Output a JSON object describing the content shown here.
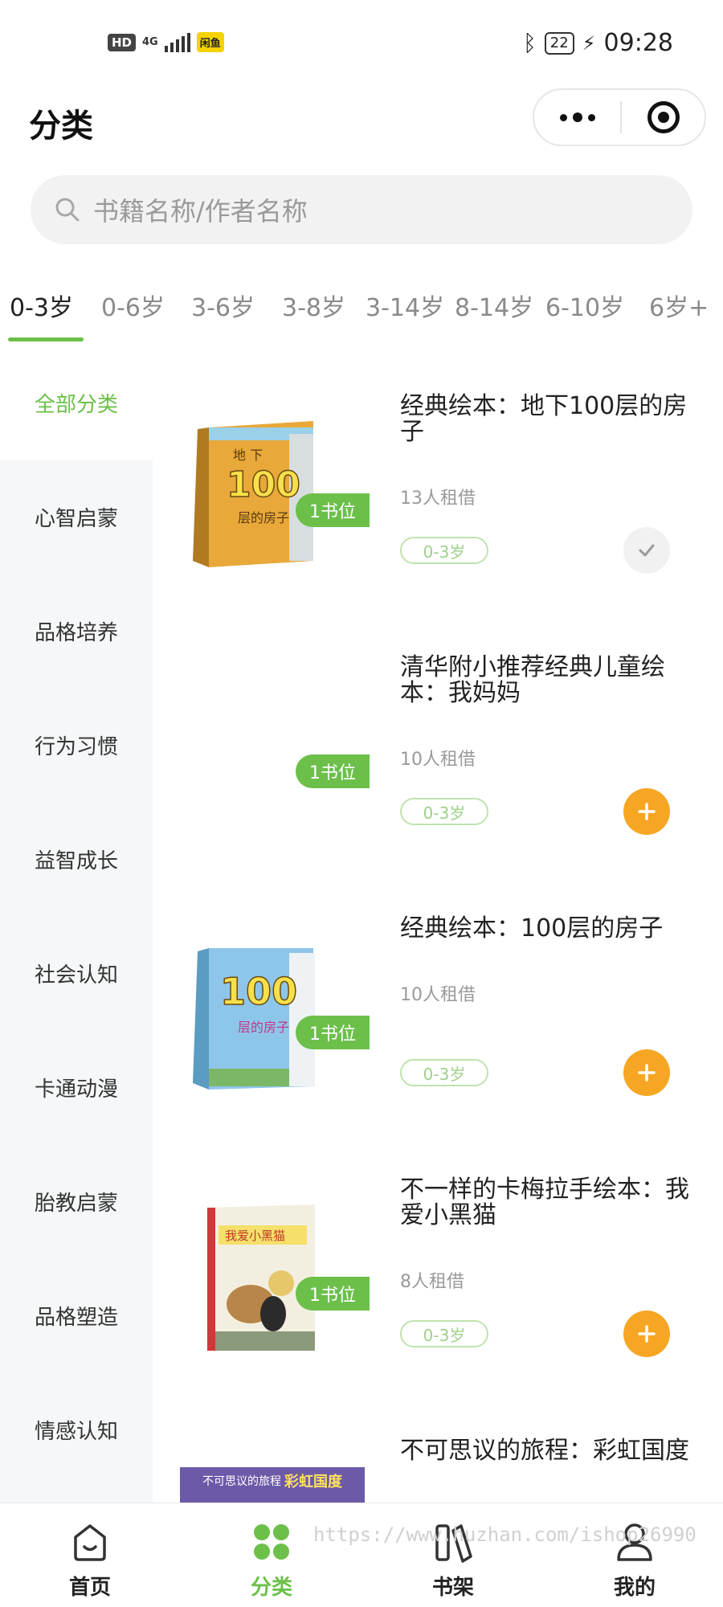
{
  "status_bar": {
    "hd": "HD",
    "network": "4G",
    "app_badge": "闲鱼",
    "battery": "22",
    "time": "09:28"
  },
  "header": {
    "title": "分类"
  },
  "search": {
    "placeholder": "书籍名称/作者名称"
  },
  "age_tabs": [
    {
      "label": "0-3岁",
      "active": true
    },
    {
      "label": "0-6岁"
    },
    {
      "label": "3-6岁"
    },
    {
      "label": "3-8岁"
    },
    {
      "label": "3-14岁"
    },
    {
      "label": "8-14岁"
    },
    {
      "label": "6-10岁"
    },
    {
      "label": "6岁+"
    }
  ],
  "sidebar": {
    "items": [
      {
        "label": "全部分类",
        "active": true
      },
      {
        "label": "心智启蒙"
      },
      {
        "label": "品格培养"
      },
      {
        "label": "行为习惯"
      },
      {
        "label": "益智成长"
      },
      {
        "label": "社会认知"
      },
      {
        "label": "卡通动漫"
      },
      {
        "label": "胎教启蒙"
      },
      {
        "label": "品格塑造"
      },
      {
        "label": "情感认知"
      }
    ]
  },
  "books": [
    {
      "title": "经典绘本：地下100层的房子",
      "rent": "13人租借",
      "age": "0-3岁",
      "badge": "1书位",
      "state": "added",
      "cover_text": "地下100层的房子"
    },
    {
      "title": "清华附小推荐经典儿童绘本：我妈妈",
      "rent": "10人租借",
      "age": "0-3岁",
      "badge": "1书位",
      "state": "add",
      "cover_text": ""
    },
    {
      "title": "经典绘本：100层的房子",
      "rent": "10人租借",
      "age": "0-3岁",
      "badge": "1书位",
      "state": "add",
      "cover_text": "100层的房子"
    },
    {
      "title": "不一样的卡梅拉手绘本：我爱小黑猫",
      "rent": "8人租借",
      "age": "0-3岁",
      "badge": "1书位",
      "state": "add",
      "cover_text": "我爱小黑猫"
    },
    {
      "title": "不可思议的旅程：彩虹国度",
      "rent": "",
      "age": "",
      "badge": "",
      "state": "",
      "cover_text": "不可思议的旅程 彩虹国度"
    }
  ],
  "bottom_nav": [
    {
      "label": "首页",
      "icon": "home-icon"
    },
    {
      "label": "分类",
      "icon": "category-icon",
      "active": true
    },
    {
      "label": "书架",
      "icon": "bookshelf-icon"
    },
    {
      "label": "我的",
      "icon": "profile-icon"
    }
  ],
  "watermark": "https://www.huzhan.com/ishop26990",
  "colors": {
    "accent_green": "#6cc04a",
    "add_orange": "#f6a623",
    "sidebar_bg": "#f6f7f9"
  }
}
